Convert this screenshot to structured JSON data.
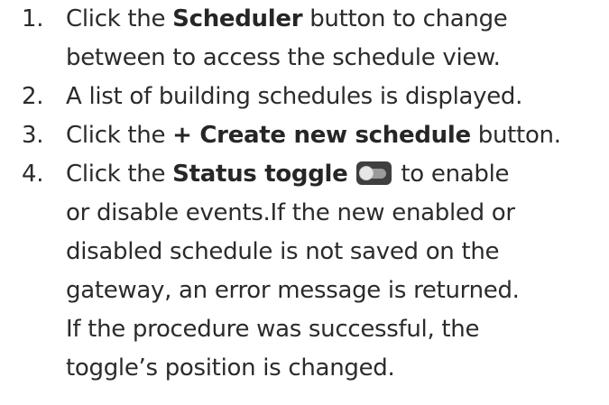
{
  "steps": [
    {
      "number": "1.",
      "line1_a": "Click the ",
      "line1_bold": "Scheduler",
      "line1_b": " button to change",
      "line2": "between to access the schedule view."
    },
    {
      "number": "2.",
      "line1": "A list of building schedules is displayed."
    },
    {
      "number": "3.",
      "line1_a": "Click the ",
      "line1_bold": "+ Create new schedule",
      "line1_b": " button."
    },
    {
      "number": "4.",
      "line1_a": "Click the ",
      "line1_bold": "Status toggle",
      "line1_b": " to enable",
      "line2": "or disable events.If the new enabled or",
      "line3": "disabled schedule is not saved on the",
      "line4": "gateway, an error message is returned.",
      "line5": "If the procedure was successful, the",
      "line6": "toggle’s position is changed."
    }
  ],
  "toggle_icon": "toggle-switch-icon"
}
